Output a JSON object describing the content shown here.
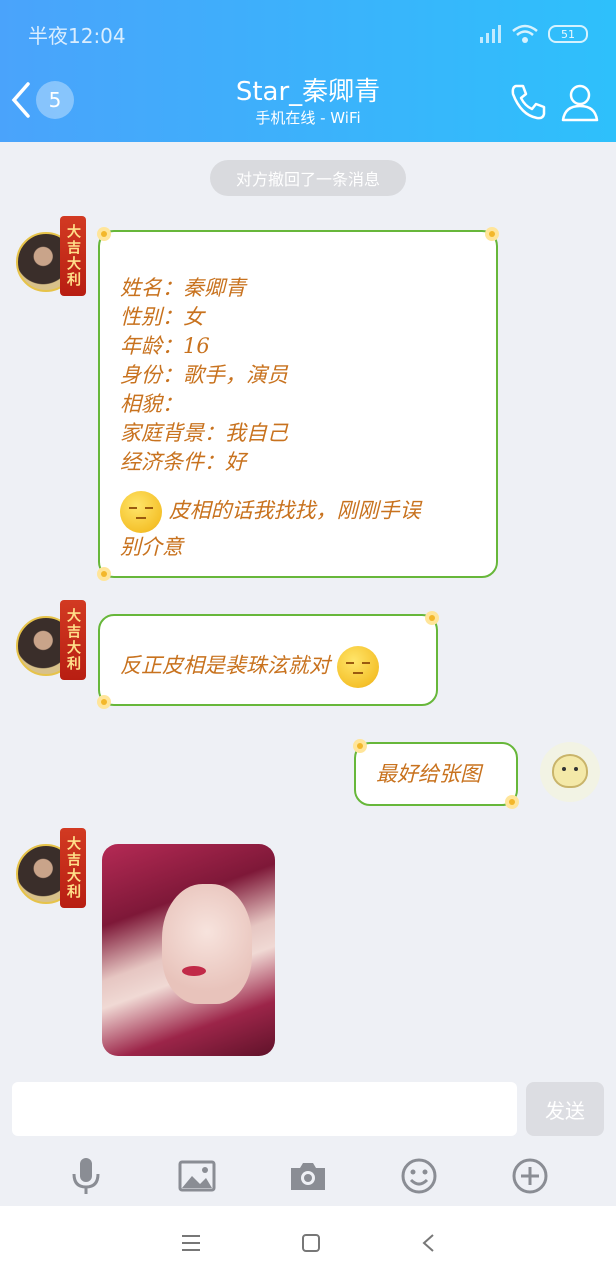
{
  "status_bar": {
    "time": "半夜12:04",
    "battery": "51"
  },
  "header": {
    "back_count": "5",
    "title": "Star_秦卿青",
    "subtitle": "手机在线 - WiFi"
  },
  "chat": {
    "recall_notice": "对方撤回了一条消息",
    "avatar_tag": "大吉大利",
    "messages": [
      {
        "lines": [
          "姓名：秦卿青",
          "性别：女",
          "年龄：16",
          "身份：歌手，演员",
          "相貌：",
          "家庭背景：我自己",
          "经济条件：好"
        ],
        "emoji_text_1": "皮相的话我找找，刚刚手误",
        "emoji_text_2": "别介意"
      },
      {
        "text": "反正皮相是裴珠泫就对"
      },
      {
        "text": "最好给张图"
      }
    ]
  },
  "input": {
    "placeholder": "",
    "send_label": "发送"
  },
  "toolbar": [
    "mic-icon",
    "image-icon",
    "camera-icon",
    "emoji-icon",
    "plus-icon"
  ],
  "colors": {
    "header_start": "#4aa3fb",
    "header_end": "#2ec0fb",
    "bubble_border": "#67b73a",
    "bubble_text": "#c8721e"
  }
}
